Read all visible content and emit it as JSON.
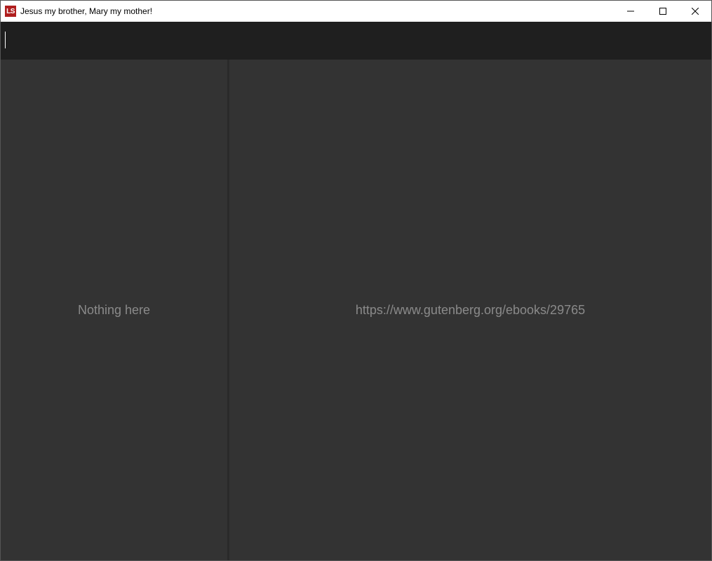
{
  "window": {
    "title": "Jesus my brother, Mary my mother!",
    "icon_text": "LS"
  },
  "toolbar": {
    "input_value": ""
  },
  "left_panel": {
    "empty_text": "Nothing here"
  },
  "right_panel": {
    "placeholder": "https://www.gutenberg.org/ebooks/29765"
  }
}
